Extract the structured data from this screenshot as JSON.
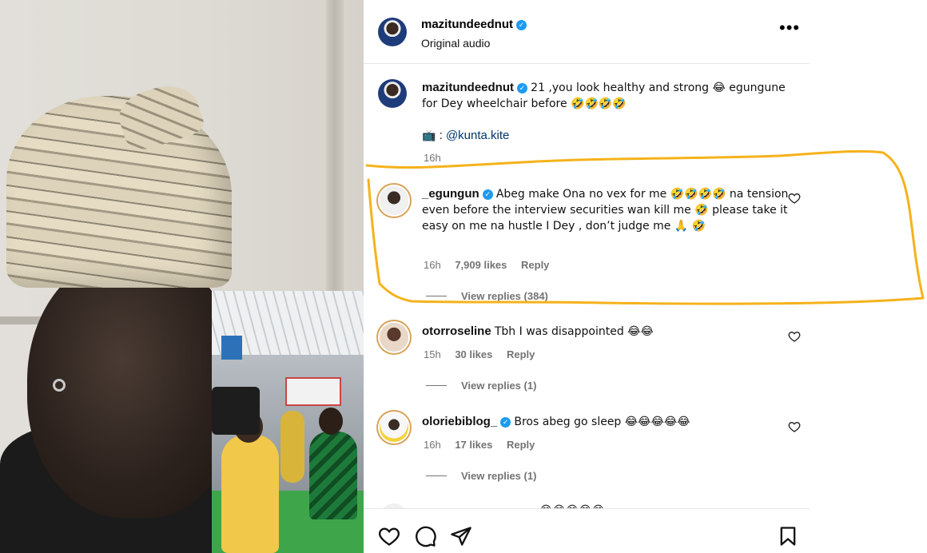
{
  "post": {
    "author": "mazitundeednut",
    "subtitle": "Original audio"
  },
  "caption": {
    "author": "mazitundeednut",
    "text": "21 ,you look healthy and strong 😂 egungune for Dey wheelchair before 🤣🤣🤣🤣",
    "credit_icon": "📺",
    "credit_sep": ":",
    "credit_handle": "@kunta.kite",
    "time": "16h"
  },
  "comments": [
    {
      "user": "_egungun",
      "verified": true,
      "text": "Abeg make Ona no vex for me 🤣🤣🤣🤣 na tension even before the interview securities wan kill me 🤣 please take it easy on me na hustle I Dey , don’t judge me 🙏 🤣",
      "time": "16h",
      "likes": "7,909 likes",
      "reply": "Reply",
      "view_replies": "View replies (384)"
    },
    {
      "user": "otorroseline",
      "verified": false,
      "text": "Tbh I was disappointed 😂😂",
      "time": "15h",
      "likes": "30 likes",
      "reply": "Reply",
      "view_replies": "View replies (1)"
    },
    {
      "user": "oloriebiblog_",
      "verified": true,
      "text": "Bros abeg go sleep 😂😂😂😂😂",
      "time": "16h",
      "likes": "17 likes",
      "reply": "Reply",
      "view_replies": "View replies (1)"
    }
  ],
  "partial_comment_emojis": "😂😂😂😂😂",
  "icons": {
    "like": "heart-icon",
    "comment": "comment-icon",
    "share": "share-icon",
    "save": "bookmark-icon",
    "more": "more-options-icon"
  },
  "colors": {
    "verified": "#1d9bf0",
    "highlight": "#f5b21b",
    "link": "#00376b",
    "muted": "#737373"
  }
}
